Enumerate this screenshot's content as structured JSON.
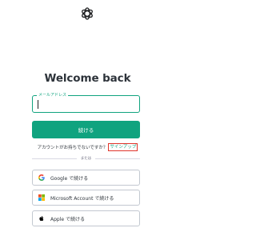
{
  "title": "Welcome back",
  "email": {
    "label": "メールアドレス",
    "value": "",
    "placeholder": ""
  },
  "continue_label": "続ける",
  "signup": {
    "prompt": "アカウントがお持ちでないですか？",
    "link_label": "サインアップ"
  },
  "divider_label": "または",
  "social": {
    "google_label": "Google で続ける",
    "microsoft_label": "Microsoft Account で続ける",
    "apple_label": "Apple で続ける"
  },
  "colors": {
    "accent": "#10a37f",
    "highlight_border": "#e0352b",
    "text": "#2d333a",
    "border": "#c2c8d0"
  },
  "icons": [
    "openai-logo-icon",
    "google-icon",
    "microsoft-icon",
    "apple-icon"
  ]
}
